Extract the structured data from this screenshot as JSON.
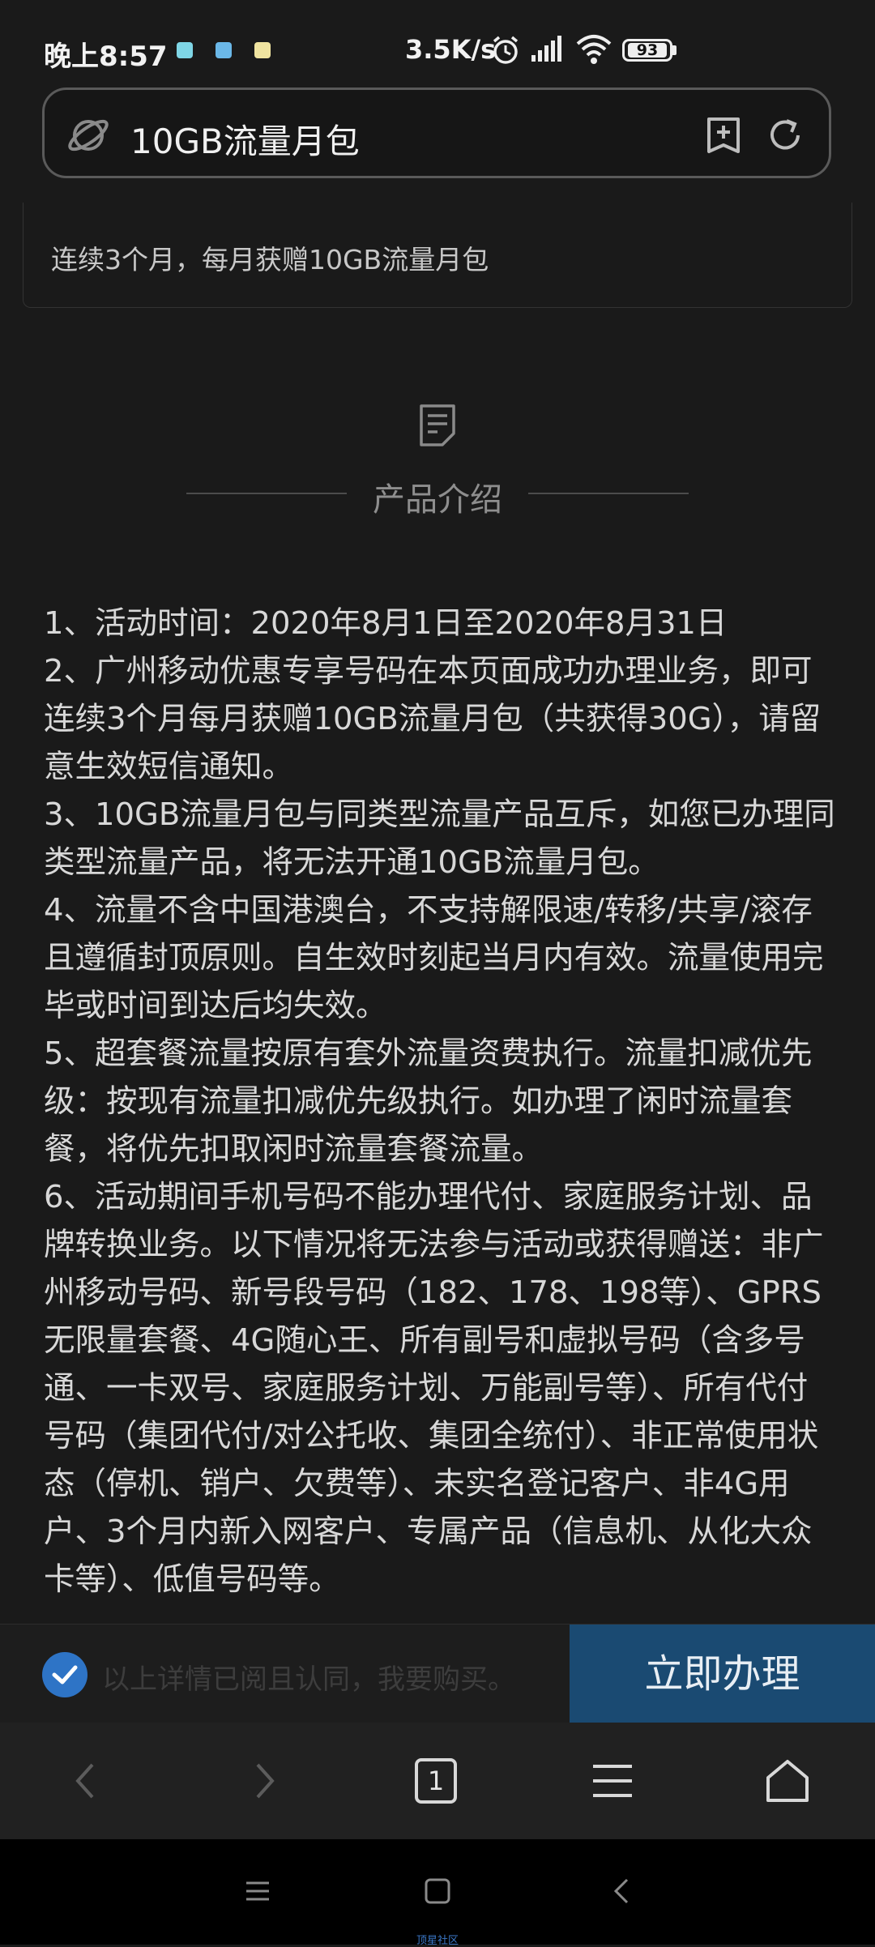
{
  "status_bar": {
    "time": "晚上8:57",
    "net_speed": "3.5K/s",
    "battery": "93"
  },
  "address_bar": {
    "url_text": "10GB流量月包"
  },
  "card": {
    "text": "连续3个月，每月获赠10GB流量月包"
  },
  "section": {
    "title": "产品介绍"
  },
  "intro_paragraphs": [
    "1、活动时间：2020年8月1日至2020年8月31日",
    "2、广州移动优惠专享号码在本页面成功办理业务，即可连续3个月每月获赠10GB流量月包（共获得30G），请留意生效短信通知。",
    "3、10GB流量月包与同类型流量产品互斥，如您已办理同类型流量产品，将无法开通10GB流量月包。",
    "4、流量不含中国港澳台，不支持解限速/转移/共享/滚存且遵循封顶原则。自生效时刻起当月内有效。流量使用完毕或时间到达后均失效。",
    "5、超套餐流量按原有套外流量资费执行。流量扣减优先级：按现有流量扣减优先级执行。如办理了闲时流量套餐，将优先扣取闲时流量套餐流量。",
    "6、活动期间手机号码不能办理代付、家庭服务计划、品牌转换业务。以下情况将无法参与活动或获得赠送：非广州移动号码、新号段号码（182、178、198等）、GPRS无限量套餐、4G随心王、所有副号和虚拟号码（含多号通、一卡双号、家庭服务计划、万能副号等）、所有代付号码（集团代付/对公托收、集团全统付）、非正常使用状态（停机、销户、欠费等）、未实名登记客户、非4G用户、3个月内新入网客户、专属产品（信息机、从化大众卡等）、低值号码等。"
  ],
  "action_bar": {
    "agree_text": "以上详情已阅且认同，我要购买。",
    "cta_label": "立即办理",
    "agree_checked": true
  },
  "browser_nav": {
    "tab_count": "1"
  },
  "watermark": "顶星社区",
  "colors": {
    "background": "#1a1a1a",
    "cta": "#1a4a72",
    "check": "#2e74c6"
  }
}
